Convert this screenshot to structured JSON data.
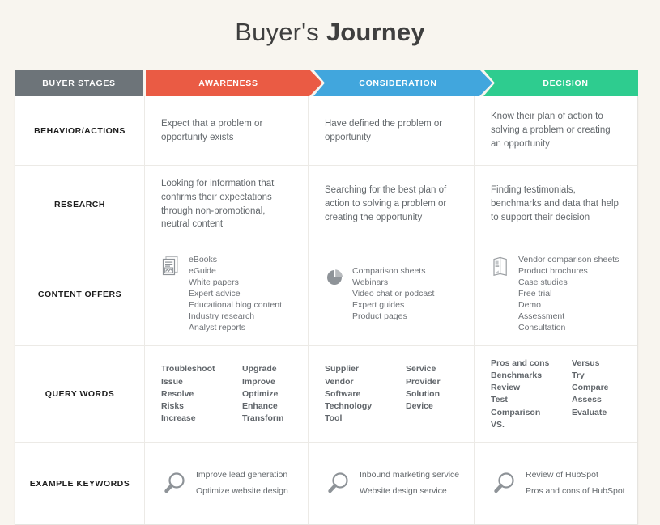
{
  "title": {
    "light": "Buyer's ",
    "bold": "Journey"
  },
  "colors": {
    "background": "#f8f5ef",
    "stages": "#6d7479",
    "awareness": "#ea5b44",
    "consideration": "#41a6dd",
    "decision": "#2ecc8f",
    "body_text": "#63686c",
    "label_text": "#1c1c1c"
  },
  "header": {
    "stages": "BUYER STAGES",
    "awareness": "AWARENESS",
    "consideration": "CONSIDERATION",
    "decision": "DECISION"
  },
  "rows": {
    "behavior": {
      "label": "BEHAVIOR/ACTIONS",
      "awareness": "Expect that a problem or opportunity exists",
      "consideration": "Have defined the problem or opportunity",
      "decision": "Know their plan of action to solving a problem or creating an opportunity"
    },
    "research": {
      "label": "RESEARCH",
      "awareness": "Looking for information that confirms their expectations through non-promotional, neutral content",
      "consideration": "Searching for the best plan of action to solving a problem or creating the opportunity",
      "decision": "Finding testimonials, benchmarks and data that help to support their decision"
    },
    "content_offers": {
      "label": "CONTENT OFFERS",
      "awareness_icon": "documents-report-icon",
      "awareness": [
        "eBooks",
        "eGuide",
        "White papers",
        "Expert advice",
        "Educational blog content",
        "Industry research",
        "Analyst reports"
      ],
      "consideration_icon": "pie-chart-icon",
      "consideration": [
        "Comparison sheets",
        "Webinars",
        "Video chat or podcast",
        "Expert guides",
        "Product pages"
      ],
      "decision_icon": "brochure-icon",
      "decision": [
        "Vendor comparison sheets",
        "Product brochures",
        "Case studies",
        "Free trial",
        "Demo",
        "Assessment",
        "Consultation"
      ]
    },
    "query_words": {
      "label": "QUERY WORDS",
      "awareness_col1": [
        "Troubleshoot",
        "Issue",
        "Resolve",
        "Risks",
        "Increase"
      ],
      "awareness_col2": [
        "Upgrade",
        "Improve",
        "Optimize",
        "Enhance",
        "Transform"
      ],
      "consideration_col1": [
        "Supplier",
        "Vendor",
        "Software",
        "Technology",
        "Tool"
      ],
      "consideration_col2": [
        "Service",
        "Provider",
        "Solution",
        "Device"
      ],
      "decision_col1": [
        "Pros and cons",
        "Benchmarks",
        "Review",
        "Test",
        "Comparison",
        "VS."
      ],
      "decision_col2": [
        "Versus",
        "Try",
        "Compare",
        "Assess",
        "Evaluate"
      ]
    },
    "example_keywords": {
      "label": "EXAMPLE KEYWORDS",
      "icon": "magnifying-glass-icon",
      "awareness": [
        "Improve lead generation",
        "Optimize website design"
      ],
      "consideration": [
        "Inbound marketing service",
        "Website design service"
      ],
      "decision": [
        "Review of HubSpot",
        "Pros and cons of HubSpot"
      ]
    }
  }
}
